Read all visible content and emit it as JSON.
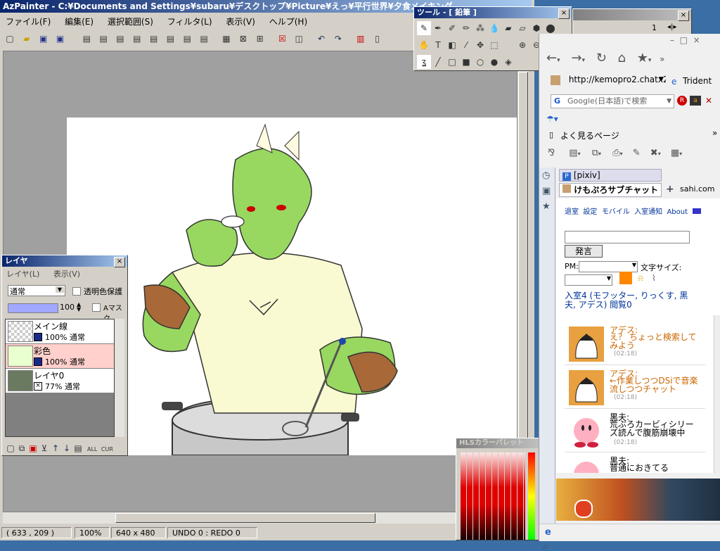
{
  "azpainter": {
    "title": "AzPainter - C:¥Documents and Settings¥subaru¥デスクトップ¥Picture¥えっ¥平行世界¥夕食メイキング",
    "menu": [
      "ファイル(F)",
      "編集(E)",
      "選択範囲(S)",
      "フィルタ(L)",
      "表示(V)",
      "ヘルプ(H)"
    ],
    "status": {
      "coords": "( 633 , 209 )",
      "zoom": "100%",
      "size": "640 x 480",
      "undo": "UNDO  0 : REDO  0"
    }
  },
  "tool_window": {
    "title": "ツール - [ 鉛筆 ]",
    "page_number": "1"
  },
  "layer_window": {
    "title": "レイヤ",
    "menu": [
      "レイヤ(L)",
      "表示(V)"
    ],
    "blend_mode": "通常",
    "protect_alpha_label": "透明色保護",
    "opacity": "100",
    "amask_label": "Aマスク",
    "layers": [
      {
        "name": "メイン線",
        "info": "100% 通常"
      },
      {
        "name": "彩色",
        "info": "100% 通常"
      },
      {
        "name": "レイヤ0",
        "info": "77%  通常"
      }
    ],
    "bottom_buttons": [
      "ALL",
      "CUR"
    ]
  },
  "hls_palette": {
    "title": "HLSカラーパレット"
  },
  "browser": {
    "url": "http://kemopro2.chatx2",
    "trident_label": "Trident",
    "search_placeholder": "Google(日本語)で検索",
    "favorites_label": "よく見るページ",
    "tabs": [
      "[pixiv]",
      "けもぷろサブチャット"
    ],
    "side_tab_text": "sahi.com",
    "chat_nav": [
      "退室",
      "設定",
      "モバイル",
      "入室通知",
      "About"
    ],
    "post_button": "発言",
    "pm_label": "PM:",
    "font_size_label": "文字サイズ:",
    "room_info": "入室4 (モフッター, りっくす, 黒夫, アデス) 閲覧0",
    "messages": [
      {
        "name": "アデス:",
        "text": "え？ ちょっと検索してみよう",
        "time": "(02:18)"
      },
      {
        "name": "アデス:",
        "text": "←作業しつつDSiで音楽流しつつチャット",
        "time": "(02:18)"
      },
      {
        "name": "黒夫:",
        "text": "荒ぶろカービィシリーズ読んで腹筋崩壊中",
        "time": "(02:18)"
      },
      {
        "name": "黒夫:",
        "text": "普通におきてる",
        "time": ""
      }
    ]
  },
  "colors": {
    "titlebar_active": "#0a246a",
    "chat_name": "#cc6600",
    "chat_link": "#003399"
  }
}
